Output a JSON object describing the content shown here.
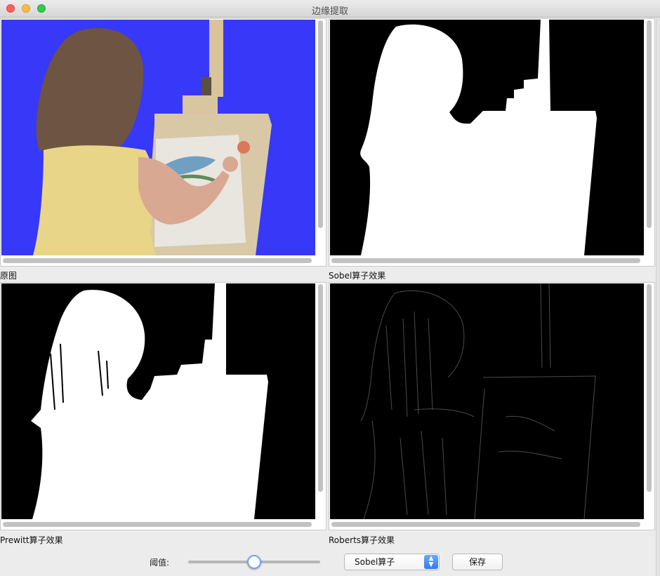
{
  "window": {
    "title": "边缘提取"
  },
  "panels": {
    "original": {
      "caption": "原图"
    },
    "sobel": {
      "caption": "Sobel算子效果"
    },
    "prewitt": {
      "caption": "Prewitt算子效果"
    },
    "roberts": {
      "caption": "Roberts算子效果"
    }
  },
  "controls": {
    "threshold_label": "阈值:",
    "threshold_level": 0.5,
    "operator_select": {
      "selected": "Sobel算子"
    },
    "save_label": "保存"
  },
  "colors": {
    "original_background": "#3838f8",
    "mask_white": "#ffffff",
    "edge_background": "#000000"
  }
}
